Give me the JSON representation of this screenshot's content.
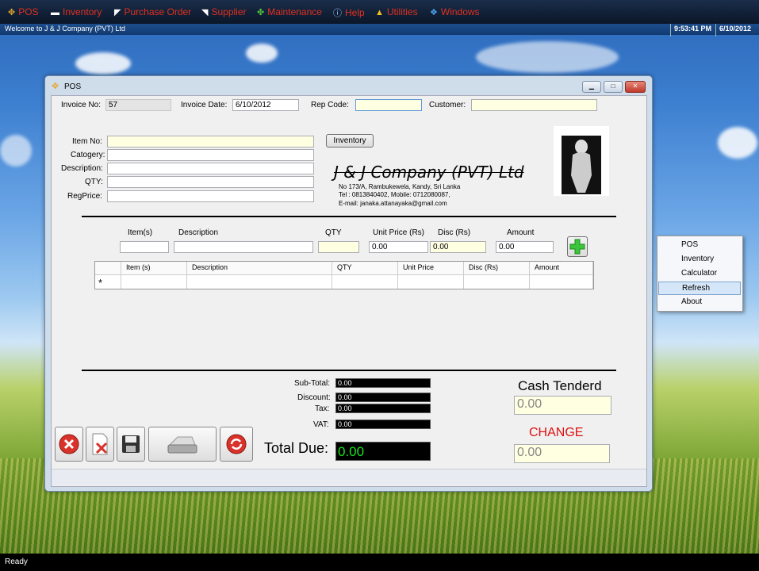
{
  "menu": {
    "items": [
      {
        "label": "POS",
        "icon": "pos-icon"
      },
      {
        "label": "Inventory",
        "icon": "inventory-icon"
      },
      {
        "label": "Purchase Order",
        "icon": "purchase-order-icon"
      },
      {
        "label": "Supplier",
        "icon": "supplier-icon"
      },
      {
        "label": "Maintenance",
        "icon": "maintenance-icon"
      },
      {
        "label": "Help",
        "icon": "help-icon"
      },
      {
        "label": "Utilities",
        "icon": "utilities-icon"
      },
      {
        "label": "Windows",
        "icon": "windows-icon"
      }
    ]
  },
  "welcome": {
    "text": "Welcome to J & J Company (PVT) Ltd",
    "time": "9:53:41 PM",
    "date": "6/10/2012"
  },
  "window": {
    "title": "POS"
  },
  "header": {
    "invoice_no_label": "Invoice No:",
    "invoice_no": "57",
    "invoice_date_label": "Invoice Date:",
    "invoice_date": "6/10/2012",
    "rep_code_label": "Rep Code:",
    "rep_code": "",
    "customer_label": "Customer:",
    "customer": ""
  },
  "item_form": {
    "item_no_label": "Item No:",
    "category_label": "Catogery:",
    "description_label": "Description:",
    "qty_label": "QTY:",
    "regprice_label": "RegPrice:",
    "inventory_button": "Inventory"
  },
  "company": {
    "name": "J & J Company (PVT) Ltd",
    "address": "No 173/A, Rambukewela, Kandy, Sri Lanka",
    "phone": "Tel : 0813840402, Mobile: 0712080087,",
    "email": "E-mail: janaka.attanayaka@gmail.com"
  },
  "entry": {
    "items_label": "Item(s)",
    "description_label": "Description",
    "qty_label": "QTY",
    "unit_price_label": "Unit Price (Rs)",
    "disc_label": "Disc (Rs)",
    "amount_label": "Amount",
    "unit_price": "0.00",
    "disc": "0.00",
    "amount": "0.00"
  },
  "grid": {
    "columns": [
      "Item (s)",
      "Description",
      "QTY",
      "Unit Price",
      "Disc (Rs)",
      "Amount"
    ],
    "new_row_marker": "*"
  },
  "totals": {
    "subtotal_label": "Sub-Total:",
    "subtotal": "0.00",
    "discount_label": "Discount:",
    "discount": "0.00",
    "tax_label": "Tax:",
    "tax": "0.00",
    "vat_label": "VAT:",
    "vat": "0.00",
    "total_due_label": "Total Due:",
    "total_due": "0.00",
    "cash_tendered_label": "Cash Tenderd",
    "cash_tendered": "0.00",
    "change_label": "CHANGE",
    "change": "0.00"
  },
  "context_menu": {
    "items": [
      "POS",
      "Inventory",
      "Calculator",
      "Refresh",
      "About"
    ],
    "selected": "Refresh"
  },
  "status": {
    "text": "Ready"
  },
  "colors": {
    "menu_text": "#e0301e",
    "change_red": "#e01010",
    "total_green": "#19e619"
  }
}
